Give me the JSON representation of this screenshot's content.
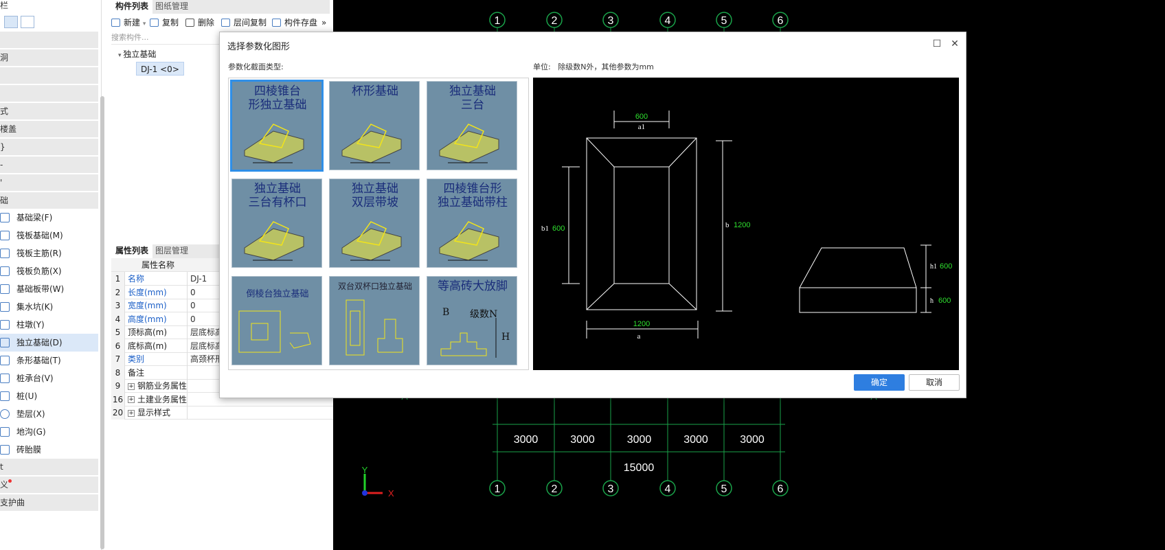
{
  "nav": {
    "header": "栏",
    "groups": [
      "",
      "洞",
      "",
      "",
      "式",
      "楼盖",
      "}",
      "-",
      "'",
      "础"
    ],
    "items": [
      {
        "label": "基础梁(F)"
      },
      {
        "label": "筏板基础(M)"
      },
      {
        "label": "筏板主筋(R)"
      },
      {
        "label": "筏板负筋(X)"
      },
      {
        "label": "基础板带(W)"
      },
      {
        "label": "集水坑(K)"
      },
      {
        "label": "柱墩(Y)"
      },
      {
        "label": "独立基础(D)"
      },
      {
        "label": "条形基础(T)"
      },
      {
        "label": "桩承台(V)"
      },
      {
        "label": "桩(U)"
      },
      {
        "label": "垫层(X)"
      },
      {
        "label": "地沟(G)"
      },
      {
        "label": "砖胎膜"
      }
    ],
    "bottom_groups": [
      "t",
      "义",
      "支护曲"
    ]
  },
  "component_panel": {
    "tabs": [
      "构件列表",
      "图纸管理"
    ],
    "toolbar": [
      "新建",
      "复制",
      "删除",
      "层间复制",
      "构件存盘"
    ],
    "search_placeholder": "搜索构件...",
    "tree_root": "独立基础",
    "tree_child": "DJ-1 <0>"
  },
  "property_panel": {
    "tabs": [
      "属性列表",
      "图层管理"
    ],
    "header": "属性名称",
    "rows": [
      {
        "no": "1",
        "key": "名称",
        "value": "DJ-1",
        "blue": true
      },
      {
        "no": "2",
        "key": "长度(mm)",
        "value": "0",
        "blue": true
      },
      {
        "no": "3",
        "key": "宽度(mm)",
        "value": "0",
        "blue": true
      },
      {
        "no": "4",
        "key": "高度(mm)",
        "value": "0",
        "blue": true
      },
      {
        "no": "5",
        "key": "顶标高(m)",
        "value": "层底标高",
        "blue": false
      },
      {
        "no": "6",
        "key": "底标高(m)",
        "value": "层底标高",
        "blue": false
      },
      {
        "no": "7",
        "key": "类别",
        "value": "高颈杯形基",
        "blue": true
      },
      {
        "no": "8",
        "key": "备注",
        "value": "",
        "blue": false
      },
      {
        "no": "9",
        "key": "钢筋业务属性",
        "value": "",
        "blue": false,
        "plus": "+"
      },
      {
        "no": "16",
        "key": "土建业务属性",
        "value": "",
        "blue": false,
        "plus": "+"
      },
      {
        "no": "20",
        "key": "显示样式",
        "value": "",
        "blue": false,
        "plus": "+"
      }
    ]
  },
  "cad": {
    "axis_labels": [
      "1",
      "2",
      "3",
      "4",
      "5",
      "6"
    ],
    "dims": [
      "3000",
      "3000",
      "3000",
      "3000",
      "3000"
    ],
    "total": "15000",
    "row_letter": "A",
    "ucs_y": "Y",
    "ucs_x": "X"
  },
  "dialog": {
    "title": "选择参数化图形",
    "type_label": "参数化截面类型:",
    "unit_label": "单位:",
    "unit_text": "除级数N外，其他参数为mm",
    "ok": "确定",
    "cancel": "取消",
    "cards": [
      {
        "title": "四棱锥台\n形独立基础",
        "sel": true
      },
      {
        "title": "杯形基础"
      },
      {
        "title": "独立基础\n三台"
      },
      {
        "title": "独立基础\n三台有杯口"
      },
      {
        "title": "独立基础\n双层带坡"
      },
      {
        "title": "四棱锥台形\n独立基础带柱"
      },
      {
        "title": "倒棱台独立基础"
      },
      {
        "title": "双台双杯口独立基础"
      },
      {
        "title": "等高砖大放脚"
      }
    ],
    "card_extra": {
      "level_n": "级数N",
      "b": "B",
      "h": "H"
    },
    "preview": {
      "a1_val": "600",
      "a1": "a1",
      "b1": "b1",
      "b1_val": "600",
      "b": "b",
      "b_val": "1200",
      "a_val": "1200",
      "a": "a",
      "h1": "h1",
      "h1_val": "600",
      "h": "h",
      "h_val": "600"
    }
  }
}
